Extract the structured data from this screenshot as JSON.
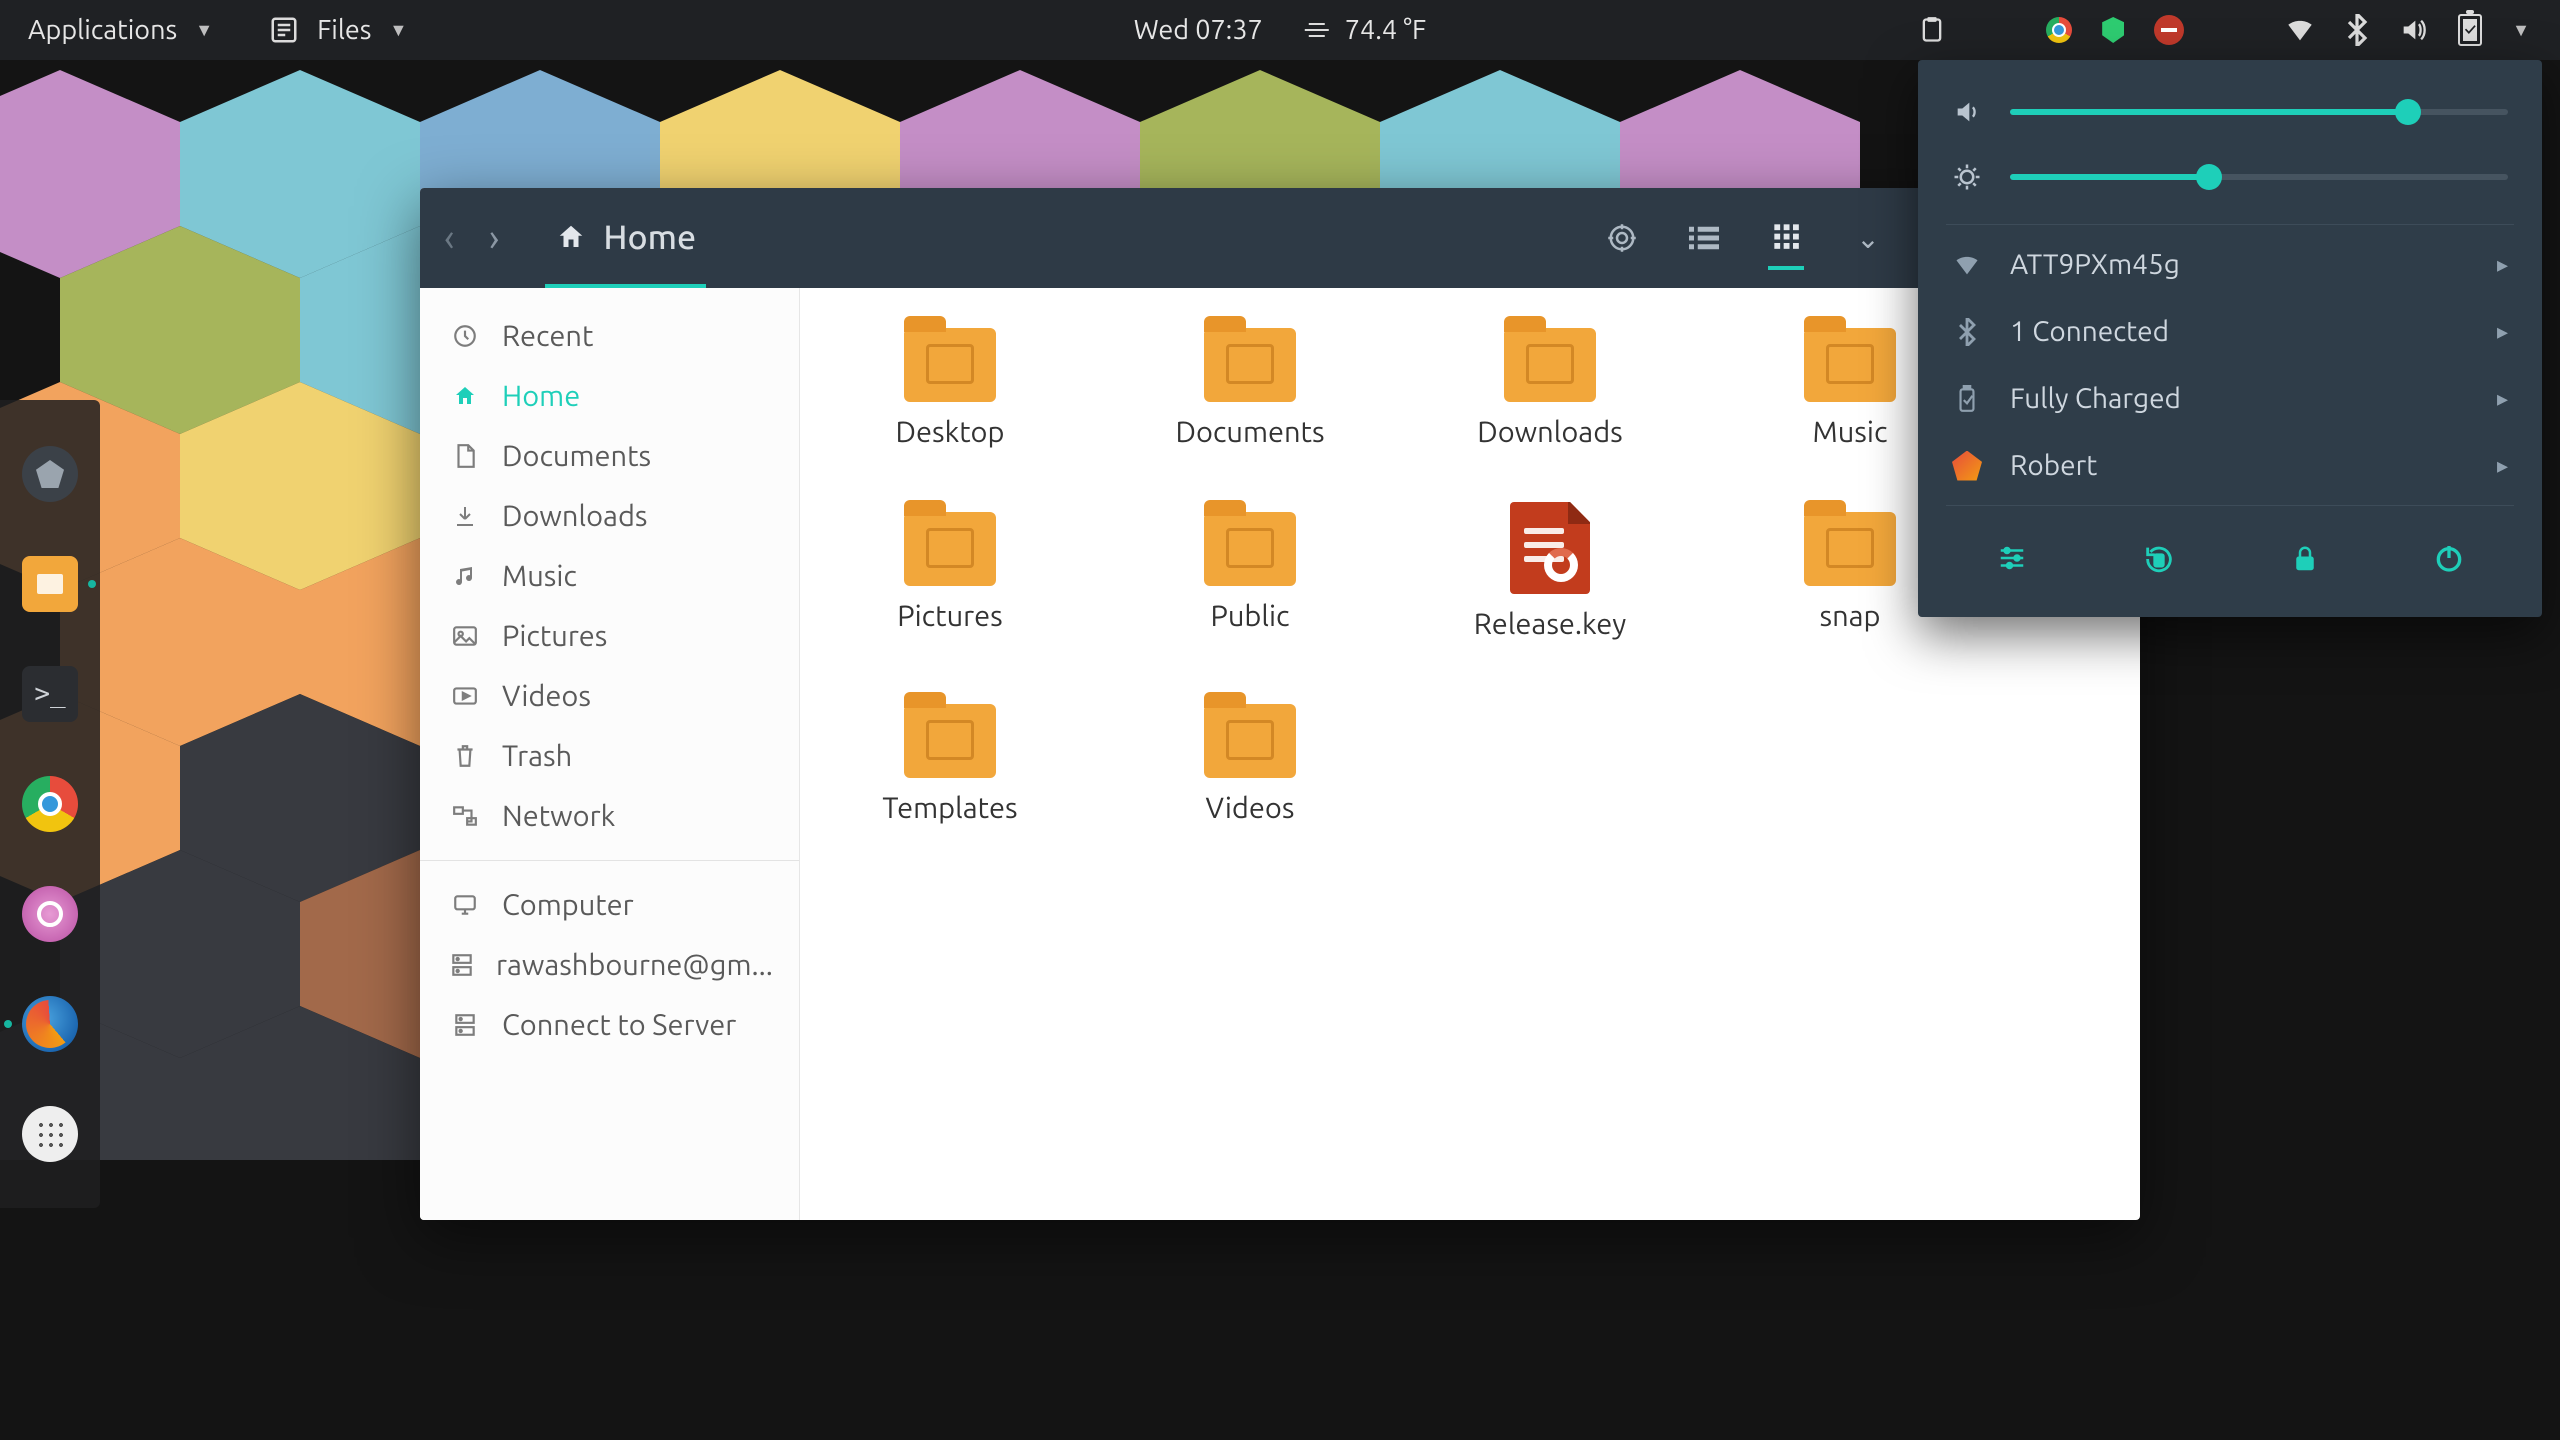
{
  "panel": {
    "applications": "Applications",
    "files": "Files",
    "datetime": "Wed 07:37",
    "temperature": "74.4 °F"
  },
  "dock": [
    {
      "name": "software-center",
      "color": "#3b4148"
    },
    {
      "name": "files-app",
      "color": "#f2a73b",
      "running": true
    },
    {
      "name": "terminal",
      "color": "#2b2d31"
    },
    {
      "name": "chrome",
      "color": "#ffffff"
    },
    {
      "name": "settings-gear",
      "color": "#d05fae"
    },
    {
      "name": "firefox",
      "color": "#0a4f9e",
      "running_left": true
    },
    {
      "name": "show-apps",
      "color": "#eeeeee"
    }
  ],
  "window": {
    "location": "Home",
    "sidebar": {
      "primary": [
        {
          "icon": "recent",
          "label": "Recent"
        },
        {
          "icon": "home",
          "label": "Home",
          "selected": true
        },
        {
          "icon": "documents",
          "label": "Documents"
        },
        {
          "icon": "downloads",
          "label": "Downloads"
        },
        {
          "icon": "music",
          "label": "Music"
        },
        {
          "icon": "pictures",
          "label": "Pictures"
        },
        {
          "icon": "videos",
          "label": "Videos"
        },
        {
          "icon": "trash",
          "label": "Trash"
        },
        {
          "icon": "network",
          "label": "Network"
        }
      ],
      "secondary": [
        {
          "icon": "computer",
          "label": "Computer"
        },
        {
          "icon": "server",
          "label": "rawashbourne@gm..."
        },
        {
          "icon": "server",
          "label": "Connect to Server"
        }
      ]
    },
    "files": [
      {
        "type": "folder",
        "label": "Desktop"
      },
      {
        "type": "folder",
        "label": "Documents"
      },
      {
        "type": "folder",
        "label": "Downloads"
      },
      {
        "type": "folder",
        "label": "Music"
      },
      {
        "type": "folder",
        "label": "Pictures"
      },
      {
        "type": "folder",
        "label": "Public"
      },
      {
        "type": "key",
        "label": "Release.key"
      },
      {
        "type": "folder",
        "label": "snap"
      },
      {
        "type": "folder",
        "label": "Templates"
      },
      {
        "type": "folder",
        "label": "Videos"
      }
    ]
  },
  "popover": {
    "volume_pct": 80,
    "brightness_pct": 40,
    "items": [
      {
        "icon": "wifi",
        "label": "ATT9PXm45g"
      },
      {
        "icon": "bluetooth",
        "label": "1 Connected"
      },
      {
        "icon": "battery",
        "label": "Fully Charged"
      },
      {
        "icon": "user",
        "label": "Robert"
      }
    ],
    "actions": [
      "settings",
      "rotation-lock",
      "lock",
      "power"
    ]
  },
  "colors": {
    "accent": "#1ecfb9",
    "folder": "#f2a73b",
    "panel": "#1f2124",
    "titlebar": "#2e3a46",
    "popover": "#2f3d49"
  }
}
